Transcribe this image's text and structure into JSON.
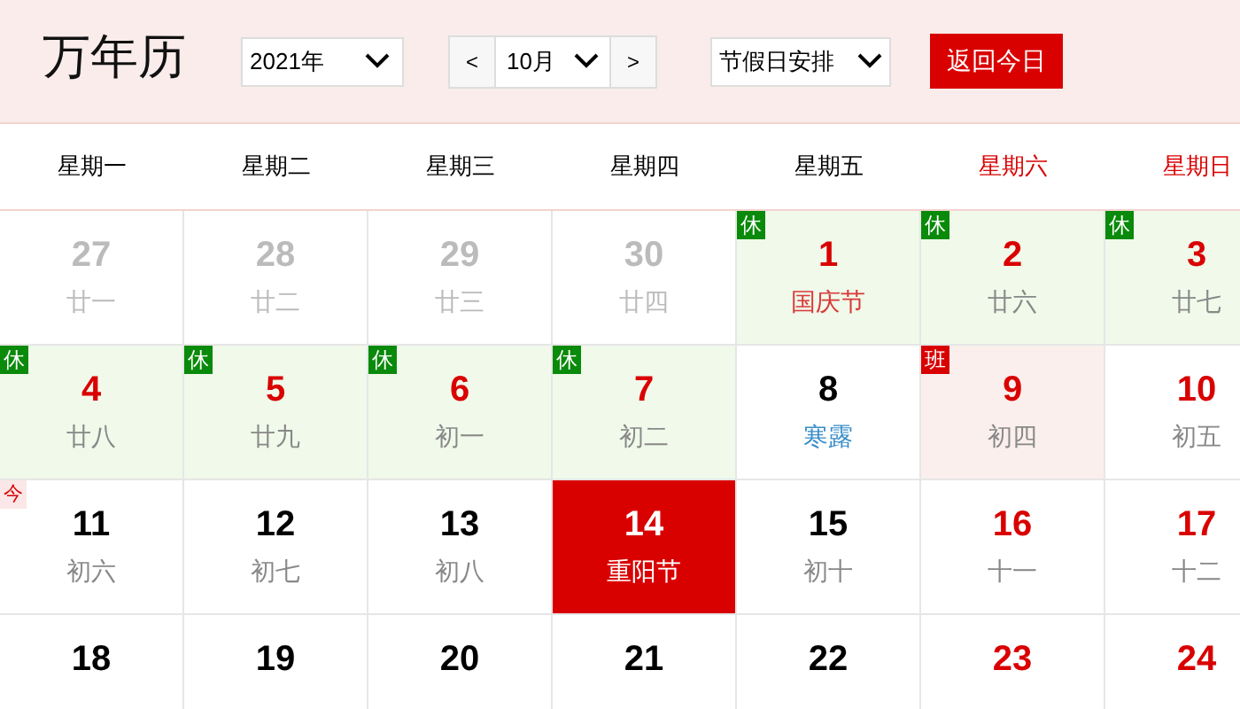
{
  "title": "万年历",
  "controls": {
    "year": "2021年",
    "prev": "<",
    "month": "10月",
    "next": ">",
    "holiday_select": "节假日安排",
    "today_button": "返回今日"
  },
  "weekdays": [
    {
      "label": "星期一",
      "weekend": false
    },
    {
      "label": "星期二",
      "weekend": false
    },
    {
      "label": "星期三",
      "weekend": false
    },
    {
      "label": "星期四",
      "weekend": false
    },
    {
      "label": "星期五",
      "weekend": false
    },
    {
      "label": "星期六",
      "weekend": true
    },
    {
      "label": "星期日",
      "weekend": true
    }
  ],
  "weeks": [
    [
      {
        "day": "27",
        "lunar": "廿一",
        "dimmed": true,
        "red": false,
        "festival": false,
        "solar_term": false,
        "selected": false
      },
      {
        "day": "28",
        "lunar": "廿二",
        "dimmed": true,
        "red": false,
        "festival": false,
        "solar_term": false,
        "selected": false
      },
      {
        "day": "29",
        "lunar": "廿三",
        "dimmed": true,
        "red": false,
        "festival": false,
        "solar_term": false,
        "selected": false
      },
      {
        "day": "30",
        "lunar": "廿四",
        "dimmed": true,
        "red": false,
        "festival": false,
        "solar_term": false,
        "selected": false
      },
      {
        "day": "1",
        "lunar": "国庆节",
        "dimmed": false,
        "red": true,
        "festival": true,
        "solar_term": false,
        "badge": {
          "kind": "rest",
          "text": "休"
        },
        "selected": false
      },
      {
        "day": "2",
        "lunar": "廿六",
        "dimmed": false,
        "red": true,
        "festival": false,
        "solar_term": false,
        "badge": {
          "kind": "rest",
          "text": "休"
        },
        "selected": false
      },
      {
        "day": "3",
        "lunar": "廿七",
        "dimmed": false,
        "red": true,
        "festival": false,
        "solar_term": false,
        "badge": {
          "kind": "rest",
          "text": "休"
        },
        "selected": false
      }
    ],
    [
      {
        "day": "4",
        "lunar": "廿八",
        "dimmed": false,
        "red": true,
        "festival": false,
        "solar_term": false,
        "badge": {
          "kind": "rest",
          "text": "休"
        },
        "selected": false
      },
      {
        "day": "5",
        "lunar": "廿九",
        "dimmed": false,
        "red": true,
        "festival": false,
        "solar_term": false,
        "badge": {
          "kind": "rest",
          "text": "休"
        },
        "selected": false
      },
      {
        "day": "6",
        "lunar": "初一",
        "dimmed": false,
        "red": true,
        "festival": false,
        "solar_term": false,
        "badge": {
          "kind": "rest",
          "text": "休"
        },
        "selected": false
      },
      {
        "day": "7",
        "lunar": "初二",
        "dimmed": false,
        "red": true,
        "festival": false,
        "solar_term": false,
        "badge": {
          "kind": "rest",
          "text": "休"
        },
        "selected": false
      },
      {
        "day": "8",
        "lunar": "寒露",
        "dimmed": false,
        "red": false,
        "festival": false,
        "solar_term": true,
        "selected": false
      },
      {
        "day": "9",
        "lunar": "初四",
        "dimmed": false,
        "red": true,
        "festival": false,
        "solar_term": false,
        "badge": {
          "kind": "work",
          "text": "班"
        },
        "selected": false
      },
      {
        "day": "10",
        "lunar": "初五",
        "dimmed": false,
        "red": true,
        "festival": false,
        "solar_term": false,
        "selected": false
      }
    ],
    [
      {
        "day": "11",
        "lunar": "初六",
        "dimmed": false,
        "red": false,
        "festival": false,
        "solar_term": false,
        "badge": {
          "kind": "today",
          "text": "今"
        },
        "selected": false
      },
      {
        "day": "12",
        "lunar": "初七",
        "dimmed": false,
        "red": false,
        "festival": false,
        "solar_term": false,
        "selected": false
      },
      {
        "day": "13",
        "lunar": "初八",
        "dimmed": false,
        "red": false,
        "festival": false,
        "solar_term": false,
        "selected": false
      },
      {
        "day": "14",
        "lunar": "重阳节",
        "dimmed": false,
        "red": false,
        "festival": true,
        "solar_term": false,
        "selected": true
      },
      {
        "day": "15",
        "lunar": "初十",
        "dimmed": false,
        "red": false,
        "festival": false,
        "solar_term": false,
        "selected": false
      },
      {
        "day": "16",
        "lunar": "十一",
        "dimmed": false,
        "red": true,
        "festival": false,
        "solar_term": false,
        "selected": false
      },
      {
        "day": "17",
        "lunar": "十二",
        "dimmed": false,
        "red": true,
        "festival": false,
        "solar_term": false,
        "selected": false
      }
    ],
    [
      {
        "day": "18",
        "dimmed": false,
        "red": false,
        "selected": false
      },
      {
        "day": "19",
        "dimmed": false,
        "red": false,
        "selected": false
      },
      {
        "day": "20",
        "dimmed": false,
        "red": false,
        "selected": false
      },
      {
        "day": "21",
        "dimmed": false,
        "red": false,
        "selected": false
      },
      {
        "day": "22",
        "dimmed": false,
        "red": false,
        "selected": false
      },
      {
        "day": "23",
        "dimmed": false,
        "red": true,
        "selected": false
      },
      {
        "day": "24",
        "dimmed": false,
        "red": true,
        "selected": false
      }
    ]
  ]
}
